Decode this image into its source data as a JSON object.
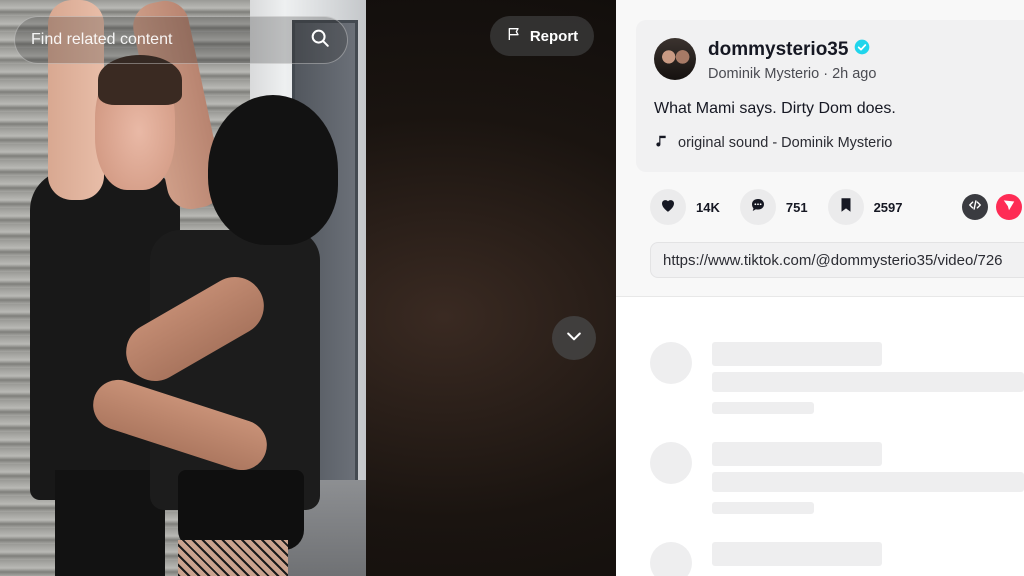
{
  "search": {
    "placeholder": "Find related content"
  },
  "report": {
    "label": "Report"
  },
  "author": {
    "username": "dommysterio35",
    "display_name": "Dominik Mysterio",
    "separator": " · ",
    "time": "2h ago"
  },
  "caption": "What Mami says. Dirty Dom does.",
  "sound": "original sound - Dominik Mysterio",
  "stats": {
    "likes": "14K",
    "comments": "751",
    "saves": "2597"
  },
  "share_url": "https://www.tiktok.com/@dommysterio35/video/726",
  "icons": {
    "search": "search-icon",
    "report": "flag-icon",
    "next": "chevron-down-icon",
    "verified": "verified-badge-icon",
    "sound": "music-note-icon",
    "like": "heart-icon",
    "comment": "comment-icon",
    "save": "bookmark-icon",
    "embed": "embed-code-icon",
    "send": "send-icon"
  },
  "colors": {
    "accent": "#fe2c55",
    "verified": "#20d5ec",
    "panel_bg": "#f8f8f8"
  }
}
